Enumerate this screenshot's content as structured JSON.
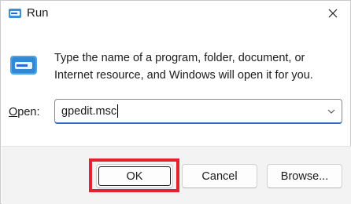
{
  "window": {
    "title": "Run",
    "close_icon": "close-icon",
    "app_icon": "run-app-icon"
  },
  "body": {
    "icon": "run-icon",
    "description": "Type the name of a program, folder, document, or Internet resource, and Windows will open it for you.",
    "open_label_prefix": "O",
    "open_label_rest": "pen:",
    "open_value": "gpedit.msc"
  },
  "buttons": {
    "ok": "OK",
    "cancel": "Cancel",
    "browse": "Browse..."
  },
  "colors": {
    "highlight": "#e0232e",
    "accent": "#2b6bd1",
    "footer_bg": "#f3f3f3"
  }
}
